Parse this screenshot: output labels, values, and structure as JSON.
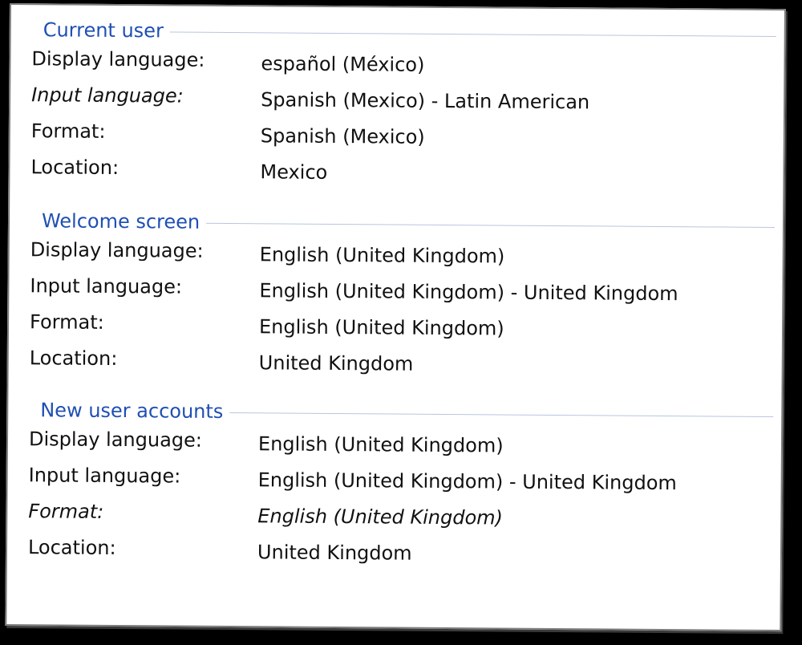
{
  "sections": [
    {
      "title": "Current user",
      "rows": [
        {
          "label": "Display language:",
          "value": "español (México)"
        },
        {
          "label": "Input language:",
          "value": "Spanish (Mexico) - Latin American"
        },
        {
          "label": "Format:",
          "value": "Spanish (Mexico)"
        },
        {
          "label": "Location:",
          "value": "Mexico"
        }
      ]
    },
    {
      "title": "Welcome screen",
      "rows": [
        {
          "label": "Display language:",
          "value": "English (United Kingdom)"
        },
        {
          "label": "Input language:",
          "value": "English (United Kingdom) - United Kingdom"
        },
        {
          "label": "Format:",
          "value": "English (United Kingdom)"
        },
        {
          "label": "Location:",
          "value": "United Kingdom"
        }
      ]
    },
    {
      "title": "New user accounts",
      "rows": [
        {
          "label": "Display language:",
          "value": "English (United Kingdom)"
        },
        {
          "label": "Input language:",
          "value": "English (United Kingdom) - United Kingdom"
        },
        {
          "label": "Format:",
          "value": "English (United Kingdom)"
        },
        {
          "label": "Location:",
          "value": "United Kingdom"
        }
      ]
    }
  ]
}
